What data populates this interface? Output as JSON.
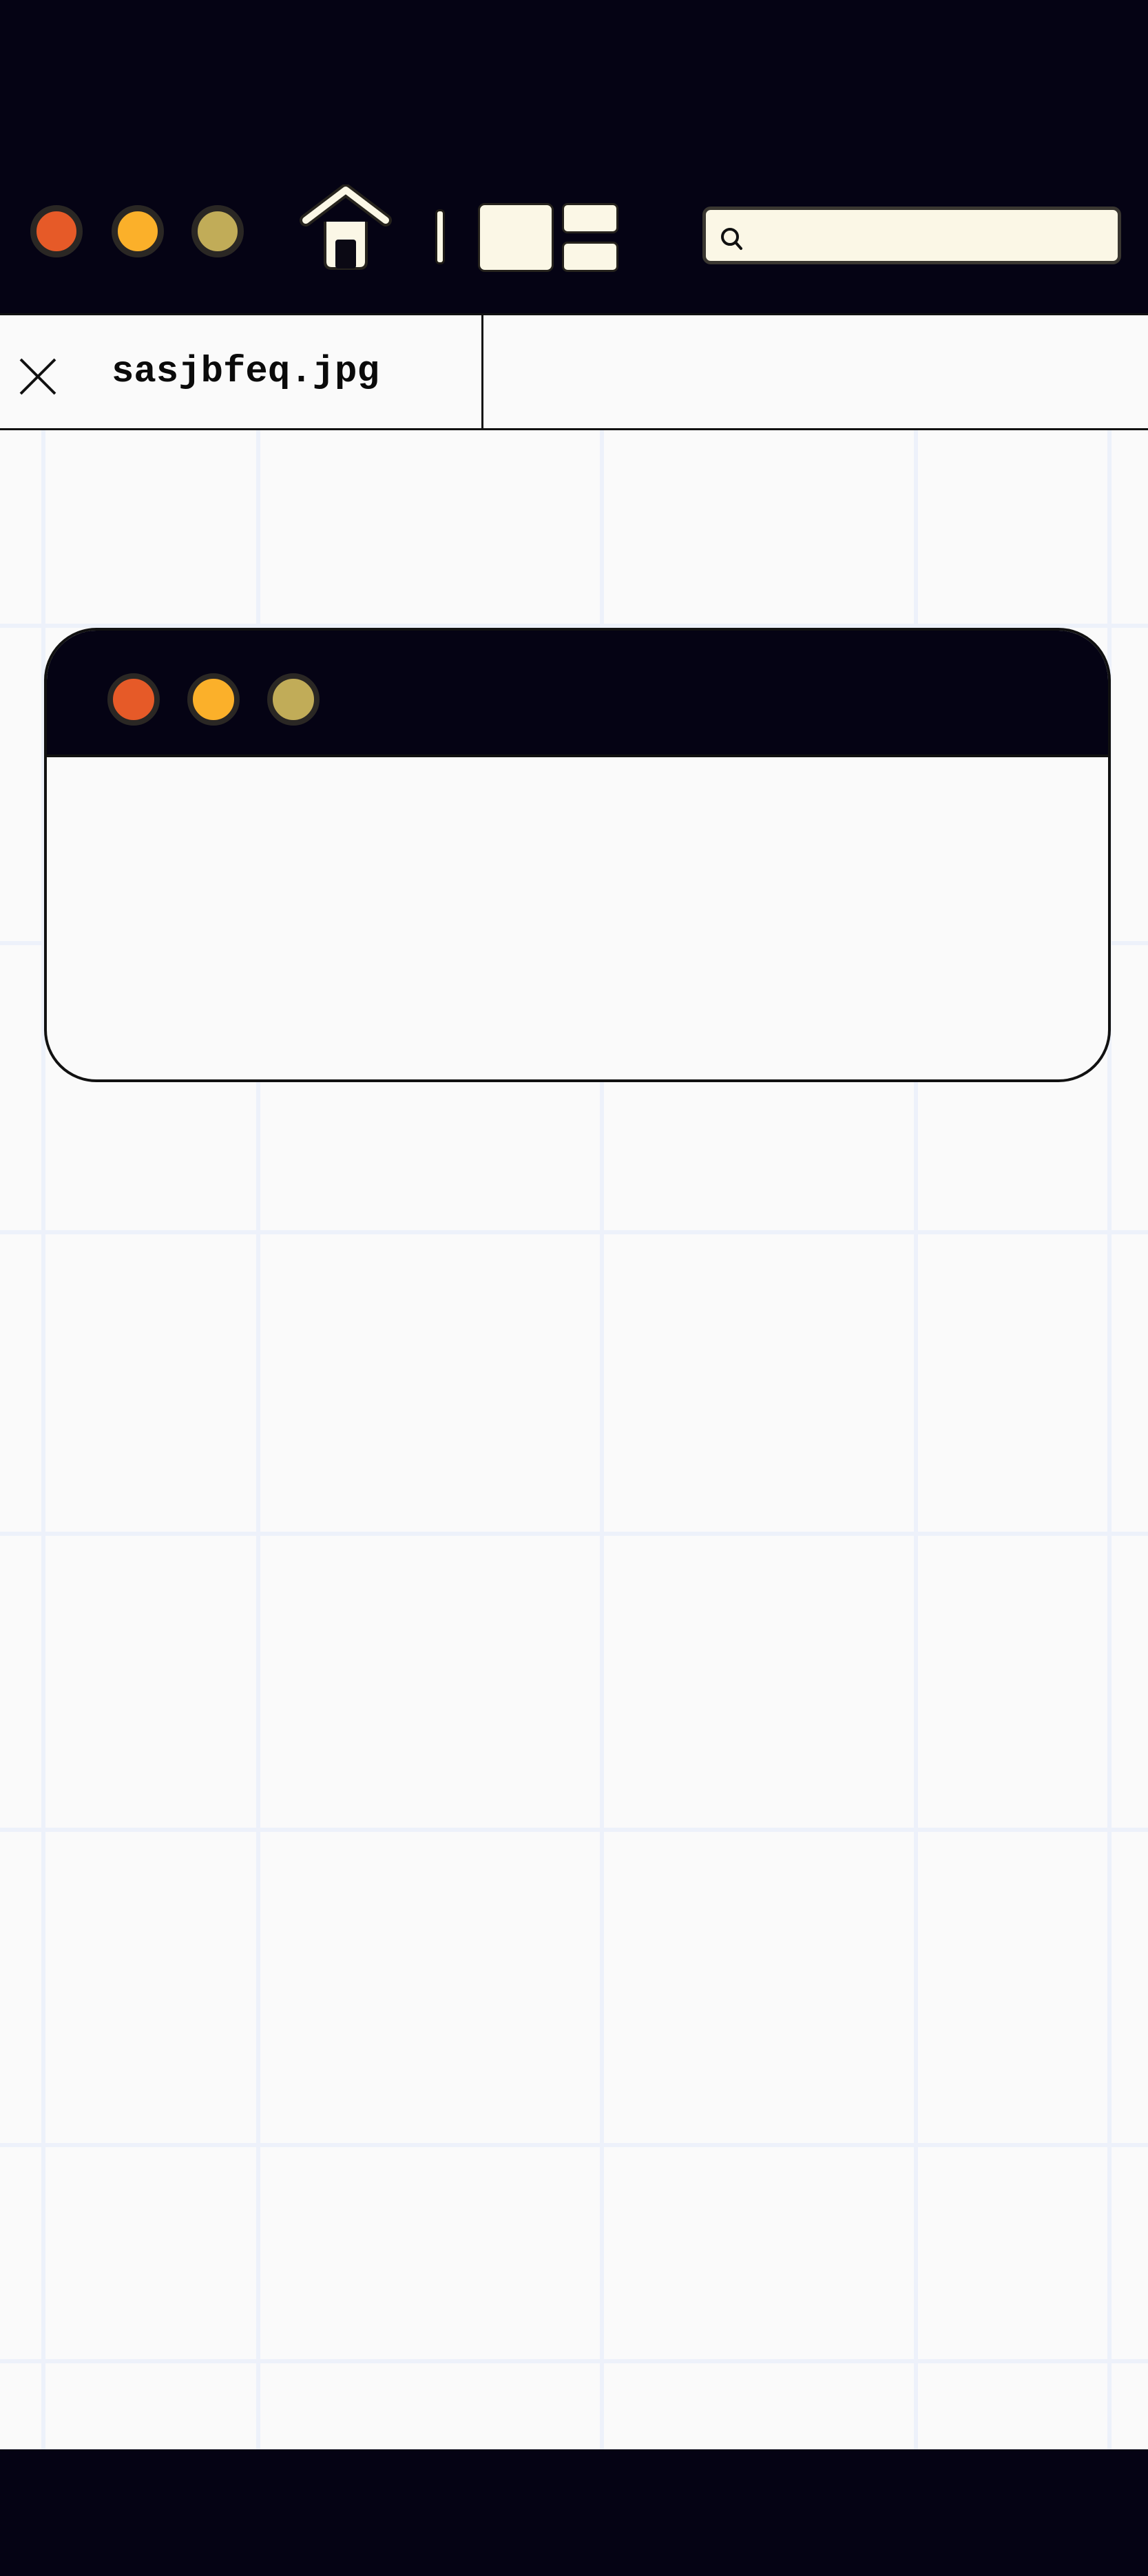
{
  "window": {
    "controls": [
      {
        "name": "close",
        "color": "#e65a28"
      },
      {
        "name": "minimize",
        "color": "#fbb02a"
      },
      {
        "name": "maximize",
        "color": "#c1ac58"
      }
    ]
  },
  "toolbar": {
    "home_icon": "home-icon",
    "layout_icon": "split-layout-icon",
    "search": {
      "value": "",
      "placeholder": "",
      "icon": "search-icon"
    }
  },
  "tabs": [
    {
      "label": "sasjbfeq.jpg",
      "close_icon": "close-icon"
    }
  ],
  "inner_window": {
    "controls": [
      {
        "name": "close",
        "color": "#e65a28"
      },
      {
        "name": "minimize",
        "color": "#fbb02a"
      },
      {
        "name": "maximize",
        "color": "#c1ac58"
      }
    ]
  },
  "colors": {
    "dark_chrome": "#050314",
    "canvas_bg": "#fafafa",
    "grid_line": "#edf1fa",
    "cream": "#fbf7e6"
  }
}
